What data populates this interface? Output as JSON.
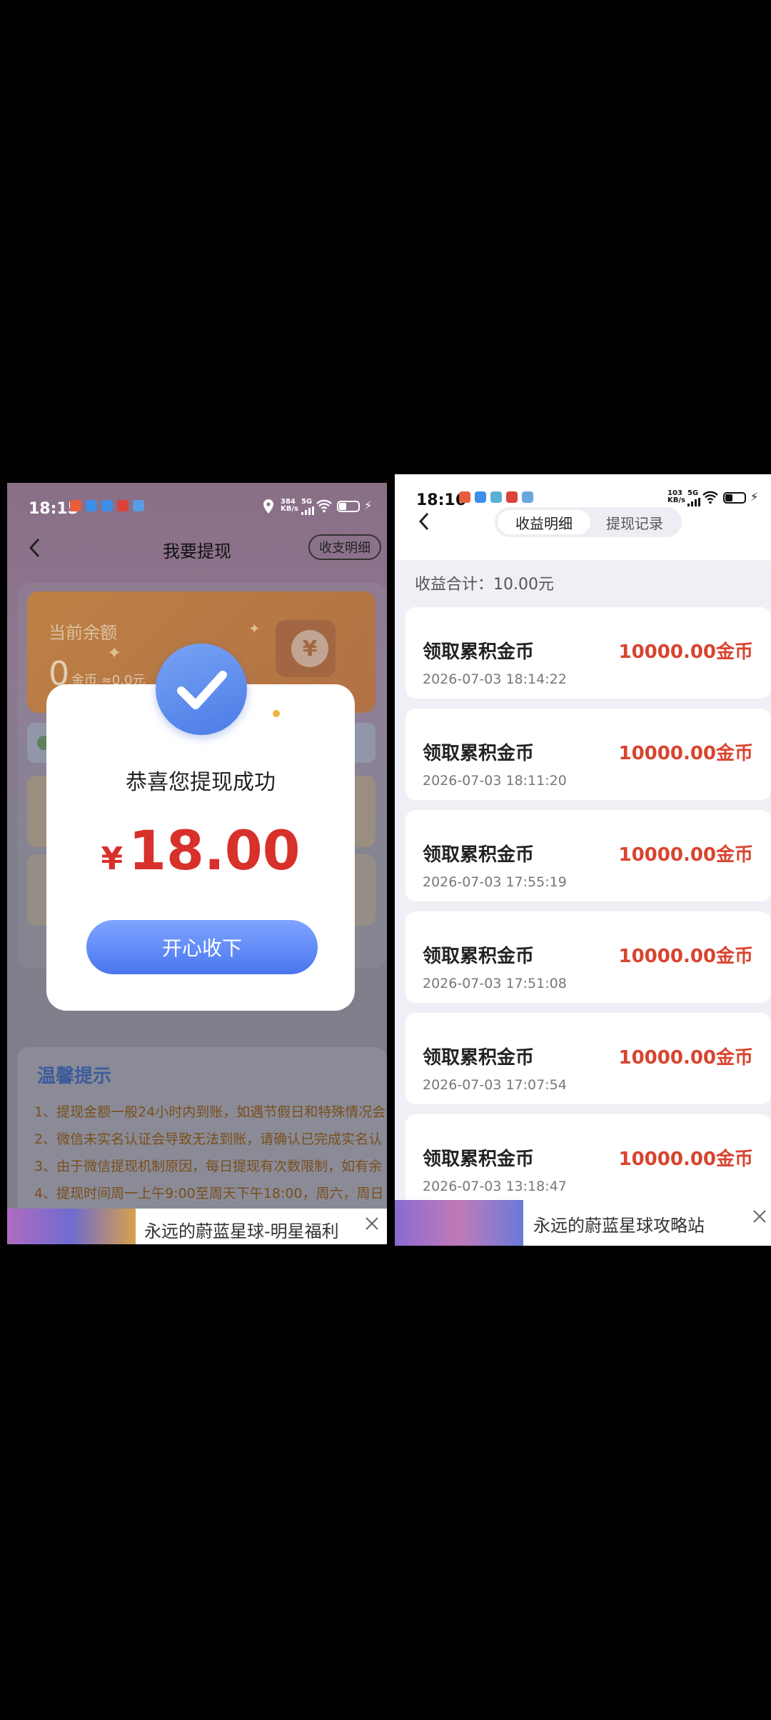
{
  "left": {
    "status": {
      "time": "18:15",
      "speed": "384\nKB/s",
      "net": "5G"
    },
    "header": {
      "title": "我要提现",
      "detail_button": "收支明细"
    },
    "balance": {
      "label": "当前余额",
      "amount": "0",
      "unit": "金币 ≈0.0元"
    },
    "popup": {
      "message": "恭喜您提现成功",
      "currency": "¥",
      "amount": "18.00",
      "button": "开心收下"
    },
    "tips": {
      "title": "温馨提示",
      "items": [
        "1、提现金额一般24小时内到账，如遇节假日和特殊情况会",
        "2、微信未实名认证会导致无法到账，请确认已完成实名认",
        "3、由于微信提现机制原因，每日提现有次数限制，如有余",
        "4、提现时间周一上午9:00至周天下午18:00，周六，周日"
      ]
    },
    "ad": {
      "text": "永远的蔚蓝星球-明星福利"
    }
  },
  "right": {
    "status": {
      "time": "18:16",
      "speed": "103\nKB/s",
      "net": "5G"
    },
    "tabs": [
      {
        "label": "收益明细",
        "active": true
      },
      {
        "label": "提现记录",
        "active": false
      }
    ],
    "total_label": "收益合计：10.00元",
    "records": [
      {
        "title": "领取累积金币",
        "date": "2026-07-03 18:14:22",
        "amount": "10000.00金币"
      },
      {
        "title": "领取累积金币",
        "date": "2026-07-03 18:11:20",
        "amount": "10000.00金币"
      },
      {
        "title": "领取累积金币",
        "date": "2026-07-03 17:55:19",
        "amount": "10000.00金币"
      },
      {
        "title": "领取累积金币",
        "date": "2026-07-03 17:51:08",
        "amount": "10000.00金币"
      },
      {
        "title": "领取累积金币",
        "date": "2026-07-03 17:07:54",
        "amount": "10000.00金币"
      },
      {
        "title": "领取累积金币",
        "date": "2026-07-03 13:18:47",
        "amount": "10000.00金币"
      }
    ],
    "ad": {
      "text": "永远的蔚蓝星球攻略站"
    }
  },
  "colors": {
    "accent_red": "#d8442f",
    "button_blue": "#4a76ee",
    "balance_orange": "#c57a2c"
  }
}
